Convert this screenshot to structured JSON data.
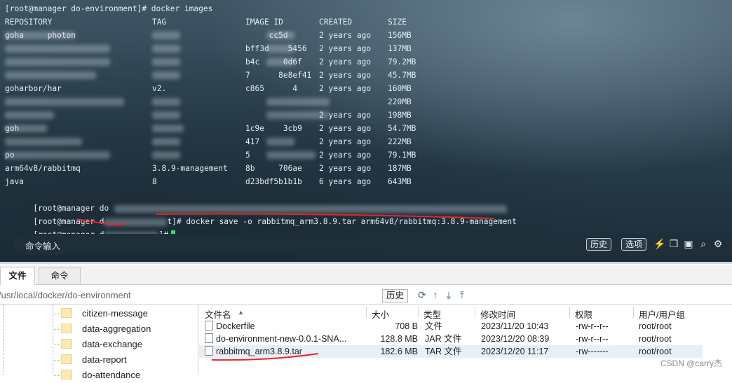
{
  "terminal": {
    "prompt1": "[root@manager do-environment]# docker images",
    "header": {
      "repository": "REPOSITORY",
      "tag": "TAG",
      "image_id": "IMAGE ID",
      "created": "CREATED",
      "size": "SIZE"
    },
    "rows": [
      {
        "repo": "goha     photon",
        "tag": "",
        "id": "     cc5d",
        "created": "2 years ago",
        "size": "156MB"
      },
      {
        "repo": "",
        "tag": "",
        "id": "bff3d    5456",
        "created": "2 years ago",
        "size": "137MB"
      },
      {
        "repo": "",
        "tag": "",
        "id": "b4c     0d6f",
        "created": "2 years ago",
        "size": "79.2MB"
      },
      {
        "repo": "",
        "tag": "",
        "id": "7      8e8ef41",
        "created": "2 years ago",
        "size": "45.7MB"
      },
      {
        "repo": "goharbor/har",
        "tag": "v2.",
        "id": "c865      4",
        "created": "2 years ago",
        "size": "160MB"
      },
      {
        "repo": "",
        "tag": "",
        "id": "",
        "created": "",
        "size": "220MB"
      },
      {
        "repo": "",
        "tag": "",
        "id": "",
        "created": "2 years ago",
        "size": "198MB"
      },
      {
        "repo": "goh",
        "tag": "",
        "id": "1c9e    3cb9",
        "created": "2 years ago",
        "size": "54.7MB"
      },
      {
        "repo": "",
        "tag": "",
        "id": "417",
        "created": "2 years ago",
        "size": "222MB"
      },
      {
        "repo": "po",
        "tag": "",
        "id": "5",
        "created": "2 years ago",
        "size": "79.1MB"
      },
      {
        "repo": "arm64v8/rabbitmq",
        "tag": "3.8.9-management",
        "id": "8b     706ae",
        "created": "2 years ago",
        "size": "187MB"
      },
      {
        "repo": "java",
        "tag": "8",
        "id": "d23bdf5b1b1b",
        "created": "6 years ago",
        "size": "643MB"
      }
    ],
    "prompt2": "[root@manager do",
    "prompt3_prefix": "[root@manager d",
    "prompt3_suffix": "t]# ",
    "save_command": "docker save -o rabbitmq_arm3.8.9.tar arm64v8/rabbitmq:3.8.9-management",
    "prompt4_prefix": "[root@manager d",
    "prompt4_suffix": "]#"
  },
  "command_bar": {
    "label": "命令输入",
    "history_button": "历史",
    "options_button": "选项"
  },
  "file_manager": {
    "tabs": [
      "文件",
      "命令"
    ],
    "path": "/usr/local/docker/do-environment",
    "history_button": "历史",
    "tree_items": [
      "citizen-message",
      "data-aggregation",
      "data-exchange",
      "data-report",
      "do-attendance"
    ],
    "columns": {
      "name": "文件名",
      "size": "大小",
      "type": "类型",
      "modified": "修改时间",
      "perm": "权限",
      "owner": "用户/用户组"
    },
    "files": [
      {
        "name": "Dockerfile",
        "size": "708 B",
        "type": "文件",
        "modified": "2023/11/20 10:43",
        "perm": "-rw-r--r--",
        "owner": "root/root"
      },
      {
        "name": "do-environment-new-0.0.1-SNA...",
        "size": "128.8 MB",
        "type": "JAR 文件",
        "modified": "2023/12/20 08:39",
        "perm": "-rw-r--r--",
        "owner": "root/root"
      },
      {
        "name": "rabbitmq_arm3.8.9.tar",
        "size": "182.6 MB",
        "type": "TAR 文件",
        "modified": "2023/12/20 11:17",
        "perm": "-rw-------",
        "owner": "root/root"
      }
    ]
  },
  "watermark": "CSDN @carry杰",
  "colors": {
    "annotation_red": "#e8242a",
    "cursor_green": "#2ee85a"
  }
}
